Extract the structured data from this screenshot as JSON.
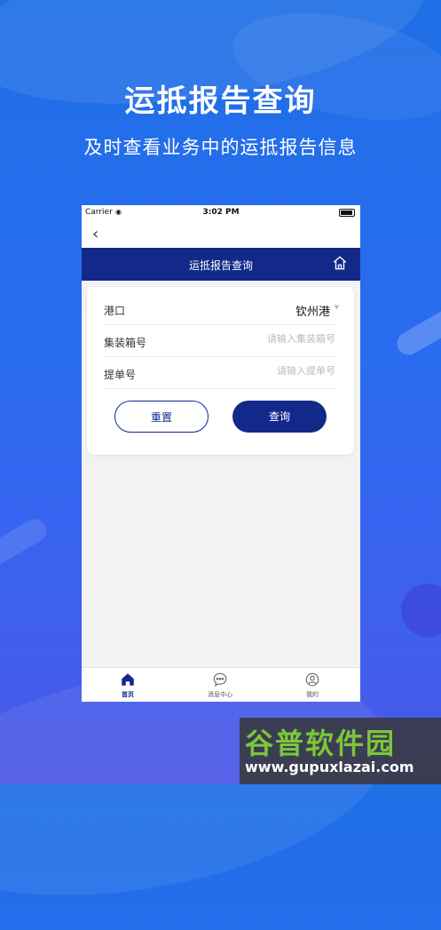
{
  "hero": {
    "title": "运抵报告查询",
    "subtitle": "及时查看业务中的运抵报告信息"
  },
  "status_bar": {
    "carrier": "Carrier",
    "time": "3:02 PM"
  },
  "page": {
    "title": "运抵报告查询"
  },
  "form": {
    "port": {
      "label": "港口",
      "value": "钦州港"
    },
    "container": {
      "label": "集装箱号",
      "placeholder": "请输入集装箱号"
    },
    "bill": {
      "label": "提单号",
      "placeholder": "请输入提单号"
    },
    "reset_label": "重置",
    "query_label": "查询"
  },
  "tabbar": {
    "items": [
      {
        "label": "首页",
        "icon": "home-icon",
        "active": true
      },
      {
        "label": "消息中心",
        "icon": "message-icon",
        "active": false
      },
      {
        "label": "我的",
        "icon": "profile-icon",
        "active": false
      }
    ]
  },
  "watermark": {
    "brand": "谷普软件园",
    "url": "www.gupuxlazai.com"
  },
  "colors": {
    "primary": "#12298a",
    "background_top": "#1f6fe6",
    "background_bottom": "#4b57e6"
  }
}
